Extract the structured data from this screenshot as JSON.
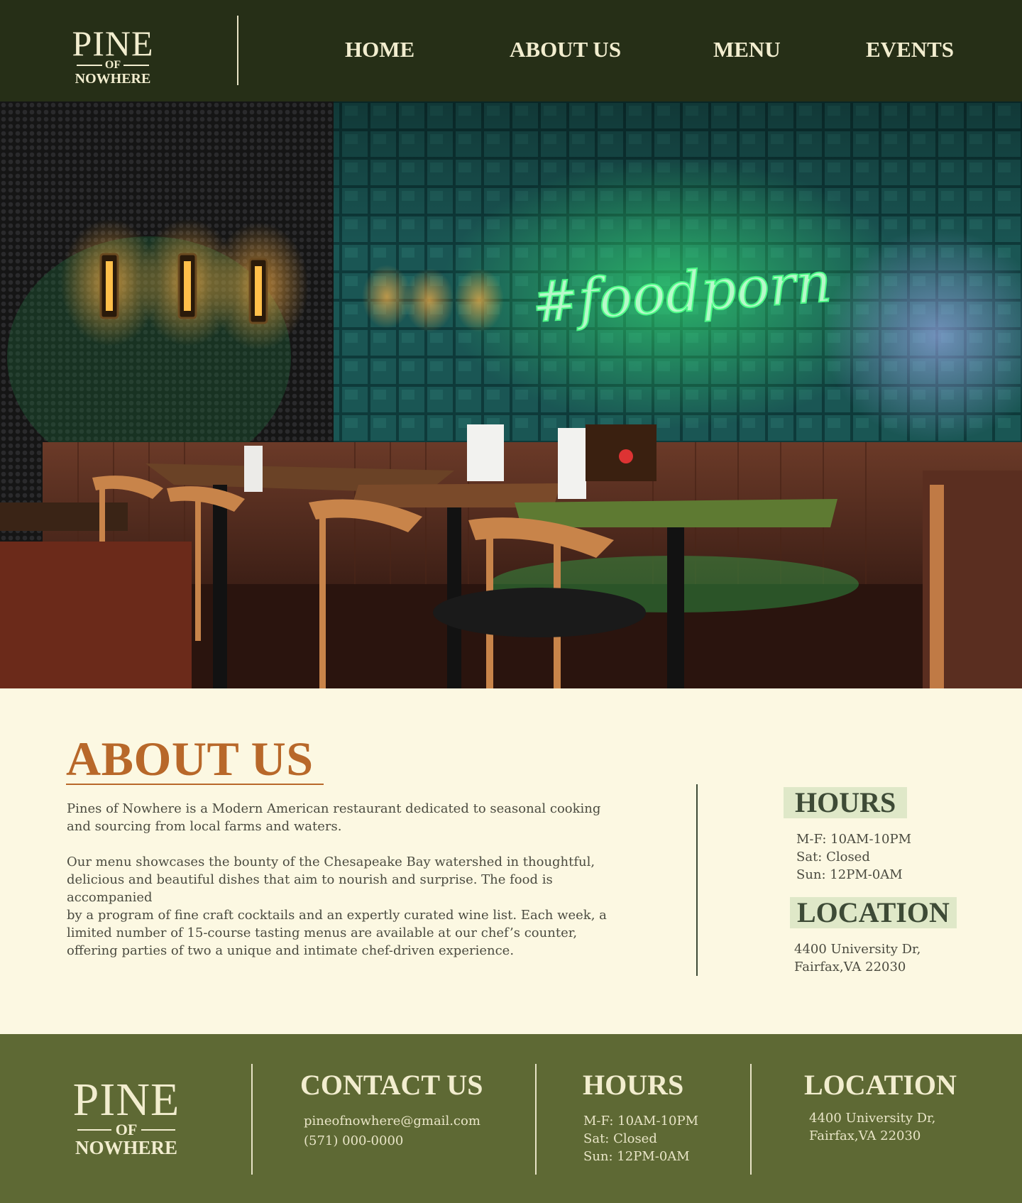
{
  "brand": {
    "line1": "PINE",
    "line2": "OF",
    "line3": "NOWHERE"
  },
  "nav": {
    "home": "HOME",
    "about": "ABOUT US",
    "menu": "MENU",
    "events": "EVENTS"
  },
  "hero": {
    "neon_text": "#foodporn"
  },
  "about": {
    "title": "ABOUT US",
    "p1_l1": "Pines of Nowhere is a Modern American restaurant dedicated to seasonal cooking",
    "p1_l2": "and sourcing from local farms and waters.",
    "p2_l1": "Our menu showcases the bounty of the Chesapeake Bay watershed in thoughtful,",
    "p2_l2": "delicious and beautiful dishes that aim to nourish and surprise. The food is accompanied",
    "p2_l3": "by a program of fine craft cocktails and an expertly curated wine list. Each week, a",
    "p2_l4": "limited number of 15-course tasting menus are available at our chef’s counter,",
    "p2_l5": "offering parties of two a unique and intimate chef-driven experience."
  },
  "hours": {
    "title": "HOURS",
    "weekdays": "M-F: 10AM-10PM",
    "saturday": "Sat: Closed",
    "sunday": "Sun: 12PM-0AM"
  },
  "location": {
    "title": "LOCATION",
    "line1": "4400 University Dr,",
    "line2": "Fairfax,VA 22030"
  },
  "contact": {
    "title": "CONTACT US",
    "email": "pineofnowhere@gmail.com",
    "phone": "(571) 000-0000"
  },
  "colors": {
    "header_bg": "#262f17",
    "page_bg": "#fcf8e2",
    "accent": "#b8682a",
    "footer_bg": "#5e6934",
    "heading_badge": "#dfe8c8"
  }
}
